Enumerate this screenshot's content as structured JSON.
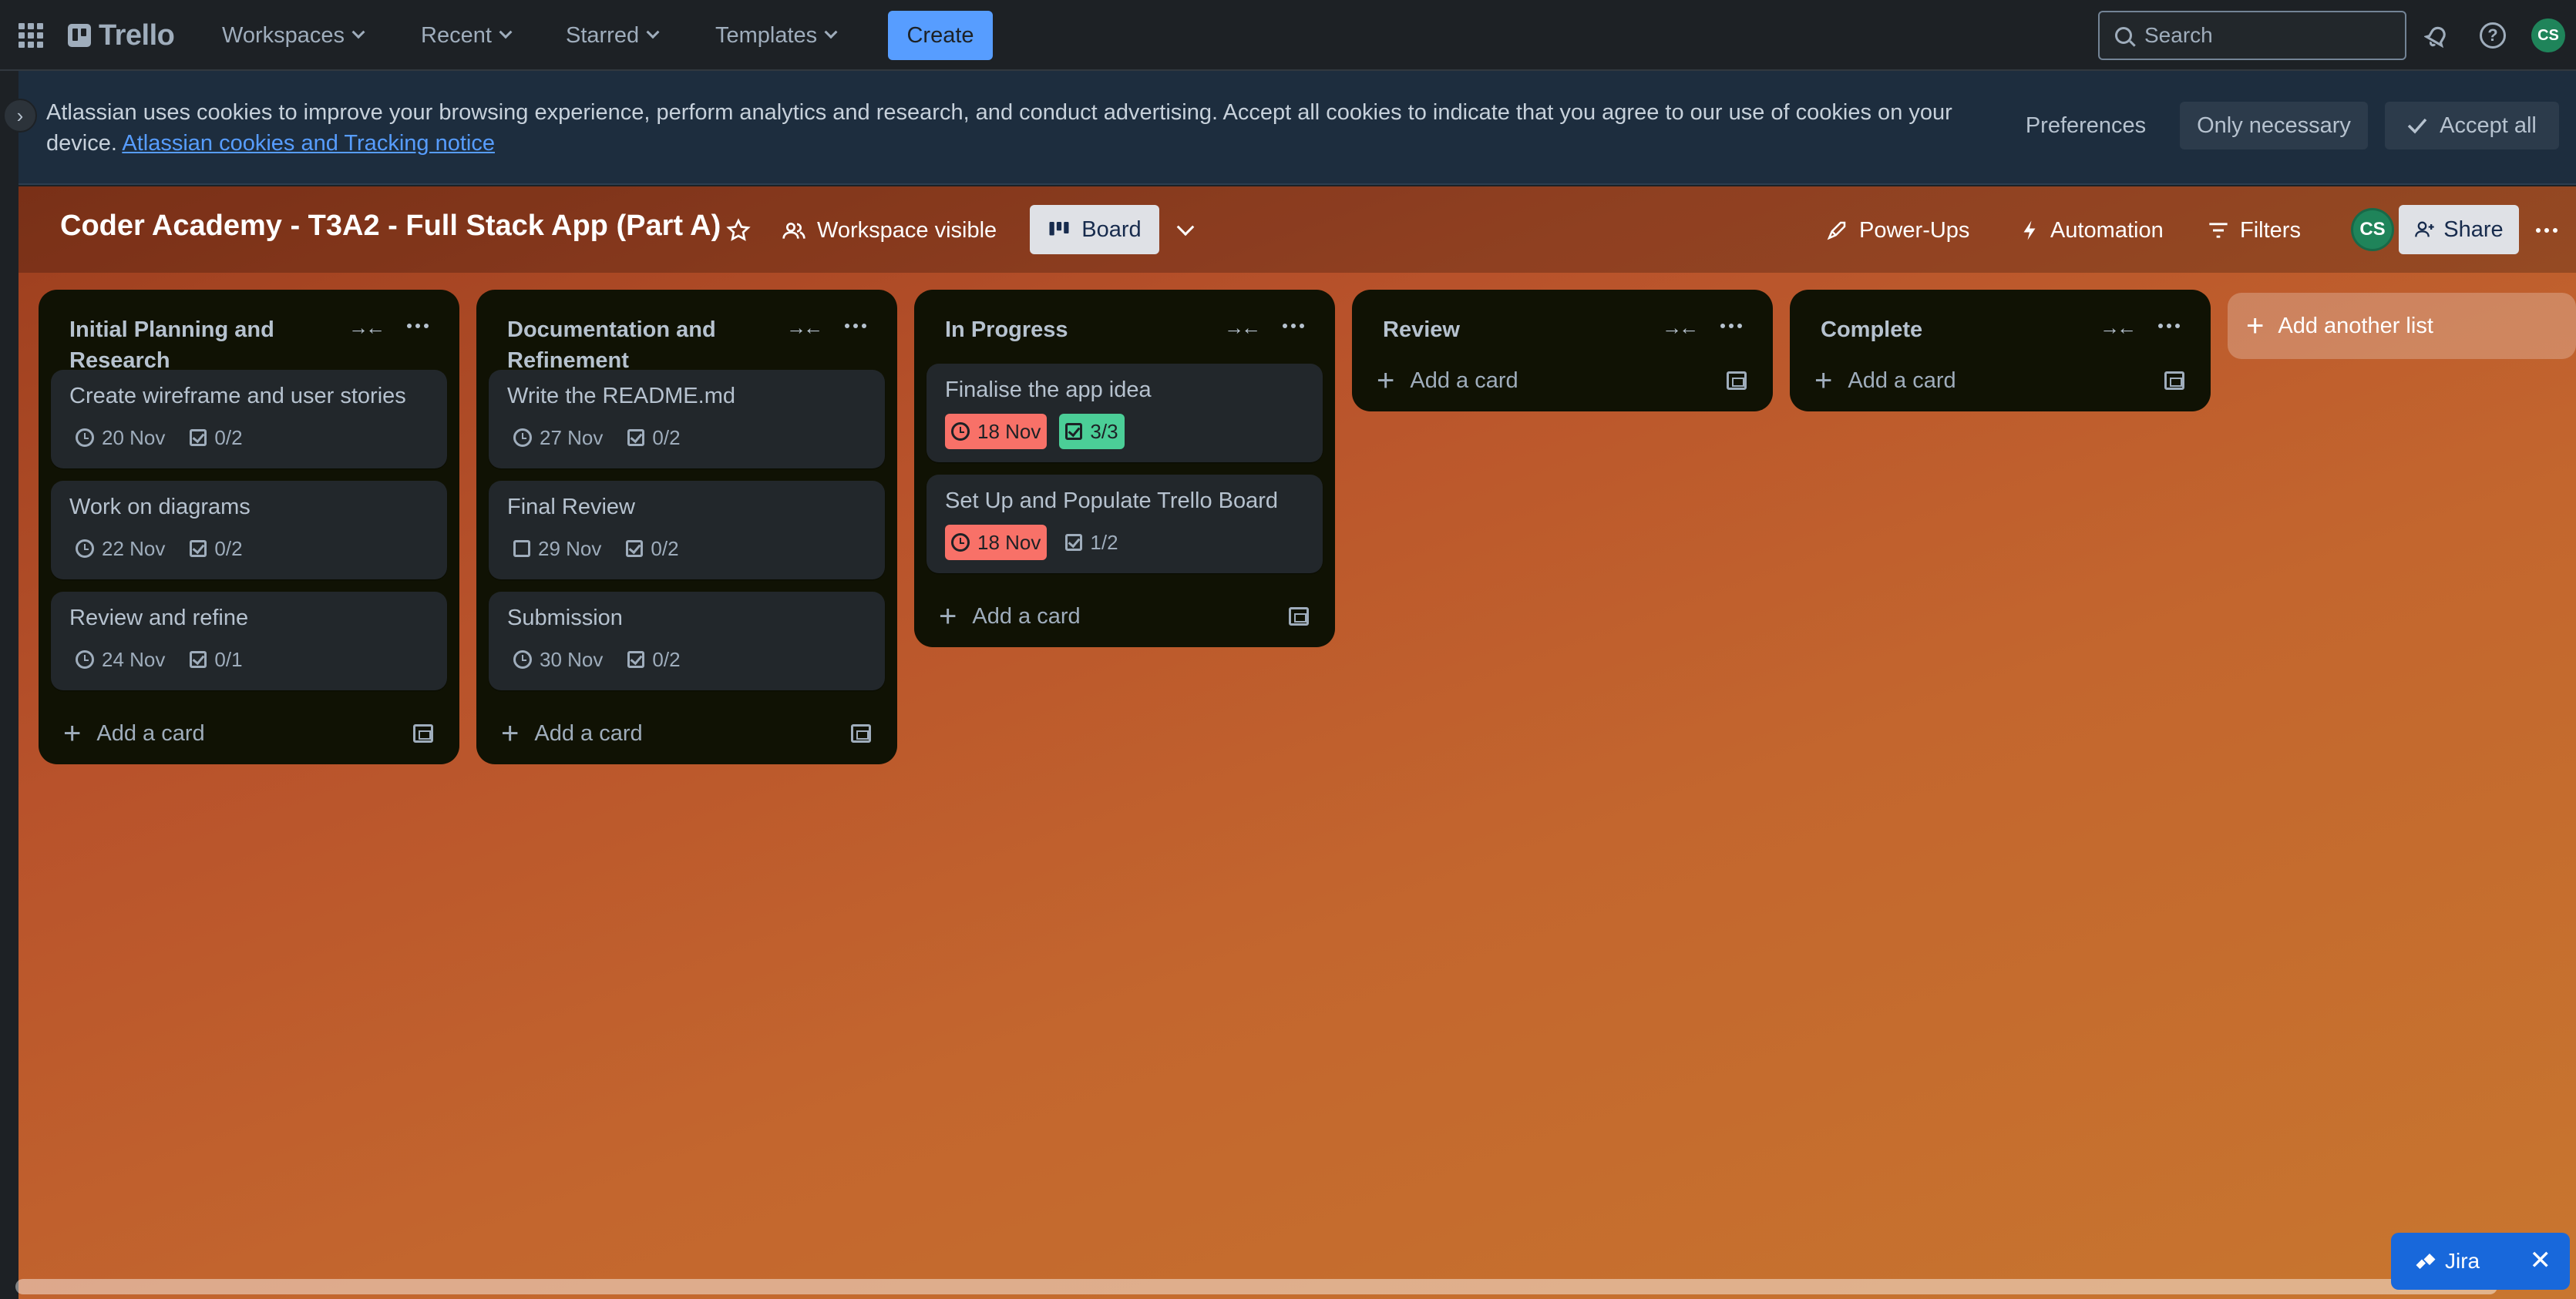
{
  "topnav": {
    "logo": "Trello",
    "menus": [
      "Workspaces",
      "Recent",
      "Starred",
      "Templates"
    ],
    "create_label": "Create",
    "search_placeholder": "Search",
    "avatar_initials": "CS"
  },
  "cookie_banner": {
    "text": "Atlassian uses cookies to improve your browsing experience, perform analytics and research, and conduct advertising. Accept all cookies to indicate that you agree to our use of cookies on your device.",
    "link": "Atlassian cookies and Tracking notice",
    "preferences": "Preferences",
    "only_necessary": "Only necessary",
    "accept_all": "Accept all"
  },
  "board": {
    "title": "Coder Academy - T3A2 - Full Stack App (Part A)",
    "visibility": "Workspace visible",
    "view": "Board",
    "power_ups": "Power-Ups",
    "automation": "Automation",
    "filters": "Filters",
    "share": "Share",
    "avatar_initials": "CS",
    "add_list": "Add another list",
    "add_card": "Add a card",
    "lists": [
      {
        "title": "Initial Planning and Research",
        "cards": [
          {
            "title": "Create wireframe and user stories",
            "date": "20 Nov",
            "checklist": "0/2"
          },
          {
            "title": "Work on diagrams",
            "date": "22 Nov",
            "checklist": "0/2"
          },
          {
            "title": "Review and refine",
            "date": "24 Nov",
            "checklist": "0/1"
          }
        ]
      },
      {
        "title": "Documentation and Refinement",
        "cards": [
          {
            "title": "Write the README.md",
            "date": "27 Nov",
            "checklist": "0/2"
          },
          {
            "title": "Final Review",
            "date": "29 Nov",
            "checklist": "0/2"
          },
          {
            "title": "Submission",
            "date": "30 Nov",
            "checklist": "0/2"
          }
        ]
      },
      {
        "title": "In Progress",
        "cards": [
          {
            "title": "Finalise the app idea",
            "date": "18 Nov",
            "checklist": "3/3"
          },
          {
            "title": "Set Up and Populate Trello Board",
            "date": "18 Nov",
            "checklist": "1/2"
          }
        ]
      },
      {
        "title": "Review",
        "cards": []
      },
      {
        "title": "Complete",
        "cards": []
      }
    ]
  },
  "jira": {
    "label": "Jira"
  }
}
